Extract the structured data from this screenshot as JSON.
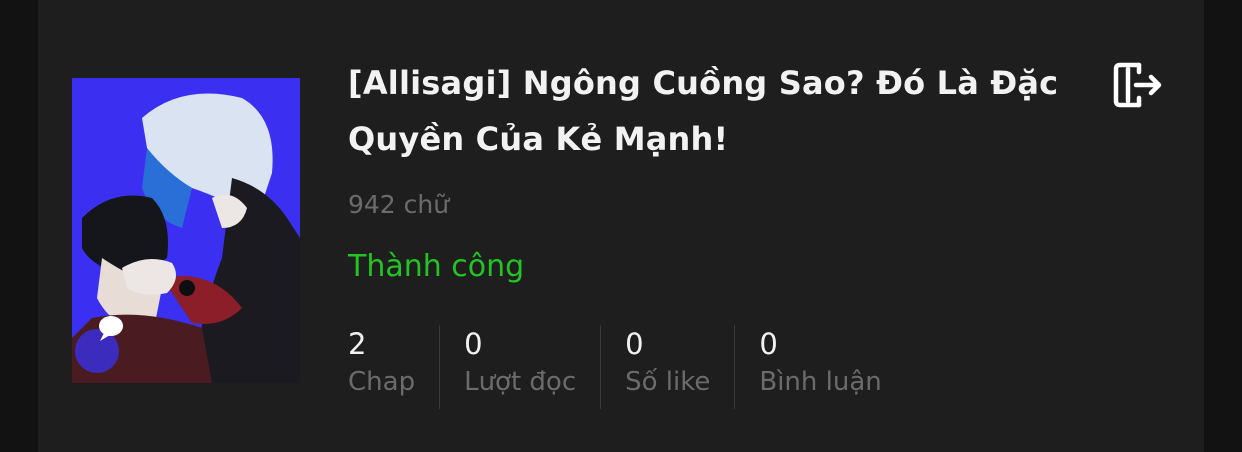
{
  "story": {
    "title": "[Allisagi] Ngông Cuồng Sao? Đó Là Đặc Quyền Của Kẻ Mạnh!",
    "word_count": "942 chữ",
    "status": "Thành công",
    "status_color": "#22c322",
    "cover_icon": "chat-bubble-icon",
    "action_icon": "exit-icon"
  },
  "stats": [
    {
      "value": "2",
      "label": "Chap"
    },
    {
      "value": "0",
      "label": "Lượt đọc"
    },
    {
      "value": "0",
      "label": "Số like"
    },
    {
      "value": "0",
      "label": "Bình luận"
    }
  ]
}
